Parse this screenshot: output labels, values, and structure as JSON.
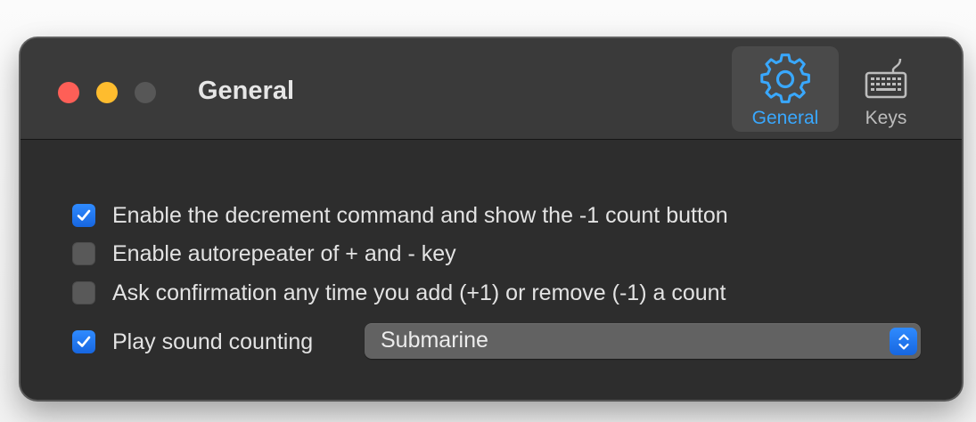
{
  "window": {
    "title": "General"
  },
  "toolbar": {
    "items": [
      {
        "label": "General",
        "icon": "gear-icon",
        "selected": true
      },
      {
        "label": "Keys",
        "icon": "keyboard-icon",
        "selected": false
      }
    ]
  },
  "options": [
    {
      "label": "Enable the decrement command and show the -1 count button",
      "checked": true
    },
    {
      "label": "Enable autorepeater of + and - key",
      "checked": false
    },
    {
      "label": "Ask confirmation any time you add (+1) or remove (-1) a count",
      "checked": false
    },
    {
      "label": "Play sound counting",
      "checked": true
    }
  ],
  "sound_select": {
    "value": "Submarine"
  },
  "colors": {
    "accent": "#1a73e8",
    "selected_tab_text": "#39a8ff",
    "close": "#fe5f57",
    "minimize": "#febc2e",
    "zoom_disabled": "#575757"
  }
}
